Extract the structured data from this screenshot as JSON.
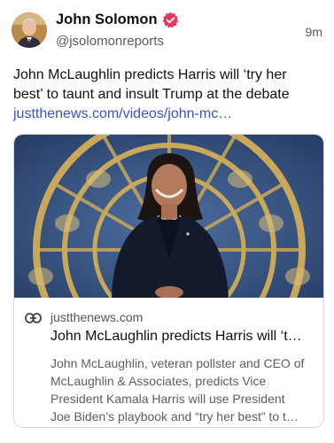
{
  "author": {
    "display_name": "John Solomon",
    "handle": "@jsolomonreports",
    "verified_icon": "verified-badge-icon",
    "verified_color": "#e8365d"
  },
  "post": {
    "time": "9m",
    "text_line1": "John McLaughlin predicts Harris will ‘try her",
    "text_line2": "best’ to taunt and insult Trump at the debate",
    "link": "justthenews.com/videos/john-mc…",
    "link_color": "#3f51c9"
  },
  "link_card": {
    "icon": "link-icon",
    "domain": "justthenews.com",
    "title": "John McLaughlin predicts Harris will ‘t…",
    "description_lines": [
      "John McLaughlin, veteran pollster and CEO of",
      "McLaughlin & Associates, predicts Vice",
      "President Kamala Harris will use President",
      "Joe Biden’s playbook and “try her best” to t…"
    ]
  }
}
